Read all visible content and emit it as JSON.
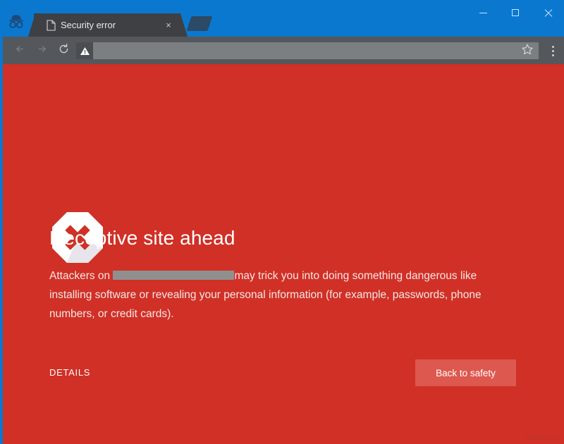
{
  "window": {
    "accent_color": "#0b78d0",
    "toolbar_color": "#54585c",
    "tab_color": "#3e4043",
    "page_background": "#d03026",
    "controls": {
      "minimize_label": "Minimize",
      "maximize_label": "Maximize",
      "close_label": "Close"
    }
  },
  "tabstrip": {
    "incognito_icon": "incognito-hat-glasses-icon",
    "tabs": [
      {
        "title": "Security error",
        "favicon": "page-document-icon",
        "close_label": "×",
        "active": true
      }
    ],
    "new_tab_label": "New tab"
  },
  "toolbar": {
    "back_icon": "arrow-left-icon",
    "forward_icon": "arrow-right-icon",
    "reload_icon": "reload-icon",
    "omnibox": {
      "security_icon": "warning-triangle-icon",
      "value": "",
      "placeholder": ""
    },
    "bookmark_icon": "star-icon",
    "menu_icon": "three-dot-menu-icon"
  },
  "interstitial": {
    "icon": "red-x-octagon-icon",
    "heading": "Deceptive site ahead",
    "body": {
      "before_redaction": "Attackers on ",
      "redaction": "",
      "after_redaction": "may trick you into doing something dangerous like installing software or revealing your personal information (for example, passwords, phone numbers, or credit cards)."
    },
    "details_label": "DETAILS",
    "primary_button_label": "Back to safety",
    "primary_button_color": "#dd584e"
  },
  "watermark": {
    "text": "wsxdn.com"
  }
}
